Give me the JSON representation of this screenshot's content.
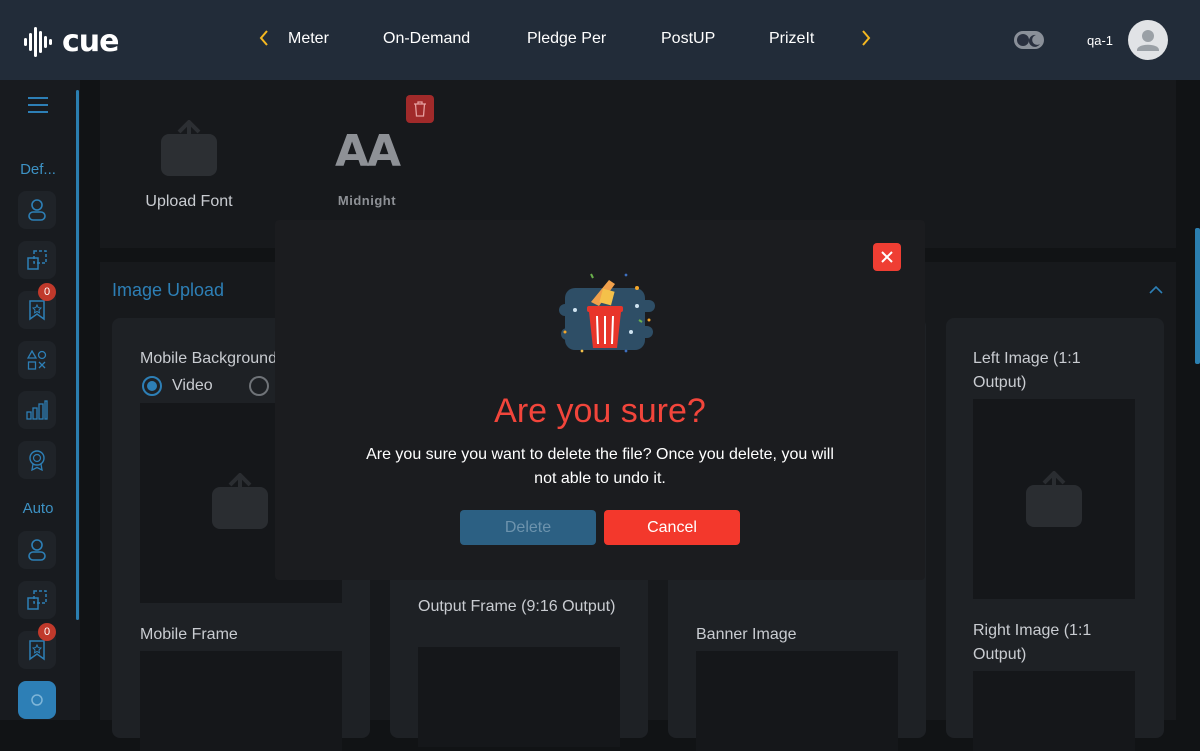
{
  "app": {
    "logo_text": "cue"
  },
  "nav": {
    "items": [
      "Meter",
      "On-Demand",
      "Pledge Per",
      "PostUP",
      "PrizeIt"
    ]
  },
  "user": {
    "name": "qa-1"
  },
  "sidebar": {
    "sections": [
      {
        "label": "Def..."
      },
      {
        "label": "Auto"
      }
    ],
    "badges": [
      "0",
      "0"
    ]
  },
  "fonts_card": {
    "upload_label": "Upload Font",
    "preview_glyphs": "AA",
    "preview_name": "Midnight"
  },
  "image_upload": {
    "title": "Image Upload",
    "tiles": [
      {
        "label": "Mobile Background",
        "radio_video": "Video"
      },
      {
        "label": "Left Image (1:1 Output)"
      },
      {
        "label": "Mobile Frame"
      },
      {
        "label": "Output Frame (9:16 Output)"
      },
      {
        "label": "Banner Image"
      },
      {
        "label": "Right Image (1:1 Output)"
      }
    ]
  },
  "modal": {
    "title": "Are you sure?",
    "message": "Are you sure you want to delete the file? Once you delete, you will not able to undo it.",
    "delete_label": "Delete",
    "cancel_label": "Cancel"
  },
  "colors": {
    "topbar": "#222c39",
    "accent_blue": "#2d7fb6",
    "accent_yellow": "#f5b820",
    "danger": "#ef3e33"
  }
}
